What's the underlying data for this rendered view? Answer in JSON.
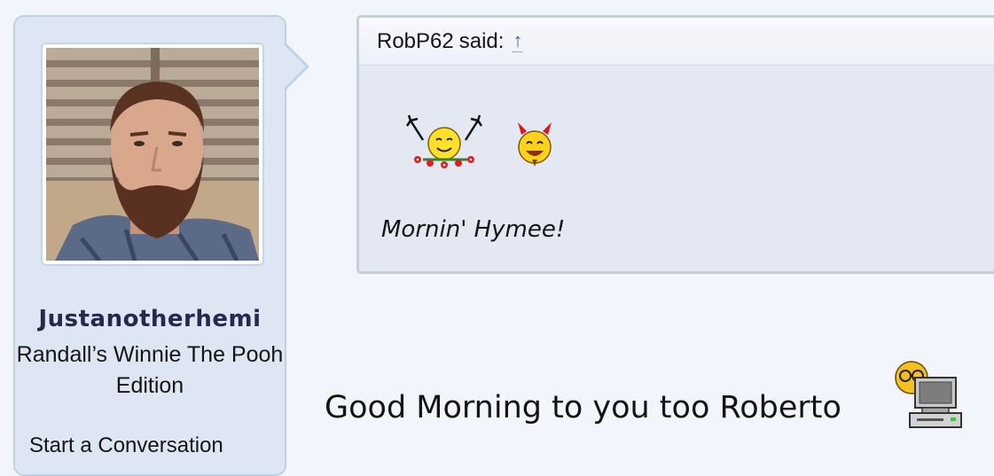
{
  "user": {
    "name": "Justanotherhemi",
    "title": "Randall’s Winnie The Pooh Edition",
    "menu_item": "Start a Conversation"
  },
  "quote": {
    "author": "RobP62",
    "said_label": "said:",
    "jump_arrow": "↑",
    "text": "Mornin' Hymee!",
    "smilies": [
      "cheering-flowers-smiley-icon",
      "devil-smiley-icon"
    ]
  },
  "post": {
    "text": "Good Morning to you too Roberto",
    "smiley": "computer-user-smiley-icon"
  },
  "colors": {
    "panel_bg": "#dfe6f3",
    "panel_border": "#bcd3e6",
    "username": "#252a4d",
    "link": "#2c6fa8",
    "quote_bg": "#e4e8f3"
  }
}
